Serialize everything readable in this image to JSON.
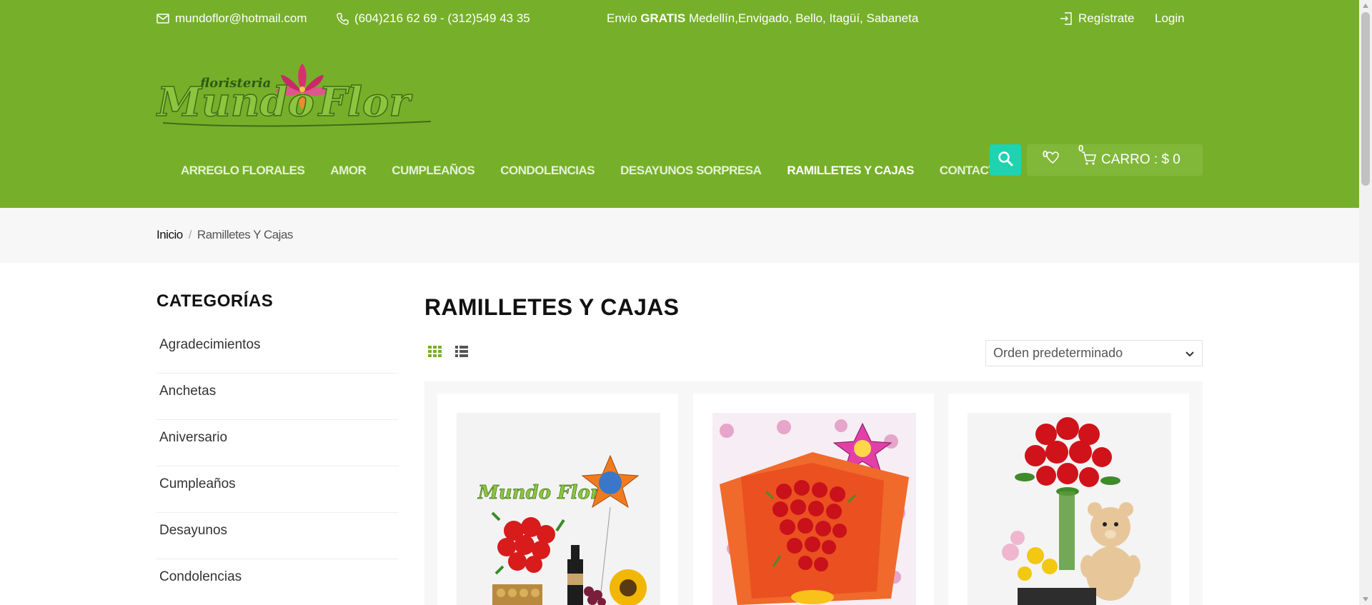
{
  "colors": {
    "brand_green": "#76b02a",
    "accent_teal": "#1fd3b1"
  },
  "topbar": {
    "email": "mundoflor@hotmail.com",
    "phone": "(604)216 62 69 - (312)549 43 35",
    "shipping_prefix": "Envio ",
    "shipping_bold": "GRATIS",
    "shipping_suffix": " Medellín,Envigado, Bello, Itagüí, Sabaneta",
    "register": "Regístrate",
    "login": "Login"
  },
  "logo": {
    "small_text": "floristeria",
    "main_text": "Mundo Flor"
  },
  "nav": {
    "items": [
      {
        "label": "ARREGLO FLORALES"
      },
      {
        "label": "AMOR"
      },
      {
        "label": "CUMPLEAÑOS"
      },
      {
        "label": "CONDOLENCIAS"
      },
      {
        "label": "DESAYUNOS SORPRESA"
      },
      {
        "label": "RAMILLETES Y CAJAS"
      },
      {
        "label": "CONTACTO"
      }
    ]
  },
  "cart": {
    "wishlist_count": "0",
    "cart_count": "0",
    "label": "CARRO : $ 0"
  },
  "breadcrumb": {
    "home": "Inicio",
    "separator": "/",
    "current": "Ramilletes Y Cajas"
  },
  "sidebar": {
    "title": "CATEGORÍAS",
    "items": [
      {
        "label": "Agradecimientos"
      },
      {
        "label": "Anchetas"
      },
      {
        "label": "Aniversario"
      },
      {
        "label": "Cumpleaños"
      },
      {
        "label": "Desayunos"
      },
      {
        "label": "Condolencias"
      }
    ]
  },
  "main": {
    "title": "RAMILLETES Y CAJAS",
    "sort_selected": "Orden predeterminado"
  },
  "icons": [
    "mail-icon",
    "phone-icon",
    "login-icon",
    "search-icon",
    "heart-icon",
    "cart-icon",
    "grid-view-icon",
    "list-view-icon",
    "chevron-down-icon"
  ]
}
